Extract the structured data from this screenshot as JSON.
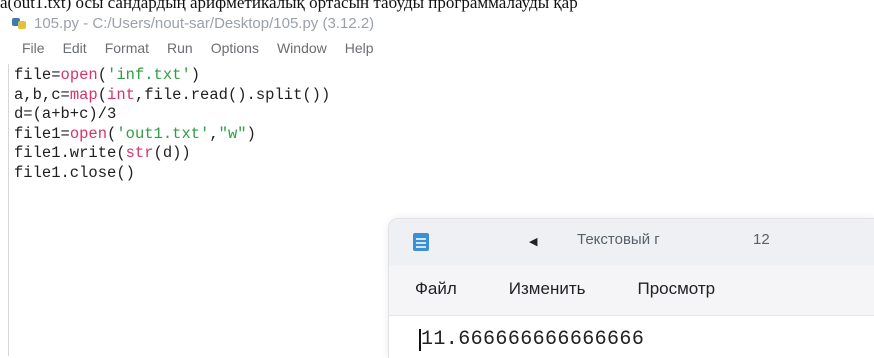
{
  "caption": "a(out1.txt) осы сандардың арифметикалық ортасын табуды программалауды қар",
  "idle": {
    "title": "105.py - C:/Users/nout-sar/Desktop/105.py (3.12.2)",
    "menu": [
      "File",
      "Edit",
      "Format",
      "Run",
      "Options",
      "Window",
      "Help"
    ],
    "code": [
      [
        "file=",
        "open",
        "(",
        "'inf.txt'",
        ")"
      ],
      [
        "a,b,c=",
        "map",
        "(",
        "int",
        ",file.read().split())"
      ],
      [
        "d=(a+b+c)/3"
      ],
      [
        "file1=",
        "open",
        "(",
        "'out1.txt'",
        ",",
        "\"w\"",
        ")"
      ],
      [
        "file1.write(",
        "str",
        "(d))"
      ],
      [
        "file1.close()"
      ]
    ]
  },
  "notepad": {
    "tab_title": "Текстовый г",
    "tab_count": "12",
    "menu": [
      "Файл",
      "Изменить",
      "Просмотр"
    ],
    "content": "11.666666666666666"
  }
}
